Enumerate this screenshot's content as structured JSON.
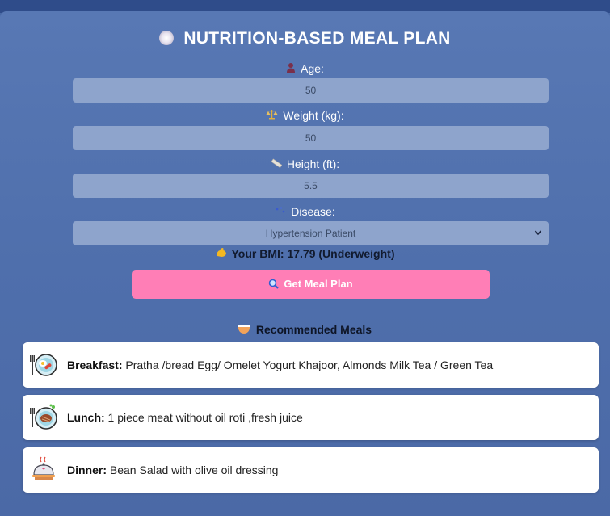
{
  "title": "NUTRITION-BASED MEAL PLAN",
  "form": {
    "age": {
      "label": "Age:",
      "value": "50",
      "icon": "person-icon"
    },
    "weight": {
      "label": "Weight (kg):",
      "value": "50",
      "icon": "scale-icon"
    },
    "height": {
      "label": "Height (ft):",
      "value": "5.5",
      "icon": "ruler-icon"
    },
    "disease": {
      "label": "Disease:",
      "value": "Hypertension Patient",
      "icon": "sparkle-icon"
    }
  },
  "bmi_text": "Your BMI: 17.79 (Underweight)",
  "button_label": "Get Meal Plan",
  "recommended_title": "Recommended Meals",
  "meals": [
    {
      "label": "Breakfast:",
      "text": "Pratha /bread Egg/ Omelet Yogurt Khajoor, Almonds Milk Tea / Green Tea"
    },
    {
      "label": "Lunch:",
      "text": "1 piece meat without oil roti ,fresh juice"
    },
    {
      "label": "Dinner:",
      "text": "Bean Salad with olive oil dressing"
    }
  ],
  "colors": {
    "background": "#4a6aa6",
    "input": "#8ea4cc",
    "button": "#ff7eb6"
  }
}
